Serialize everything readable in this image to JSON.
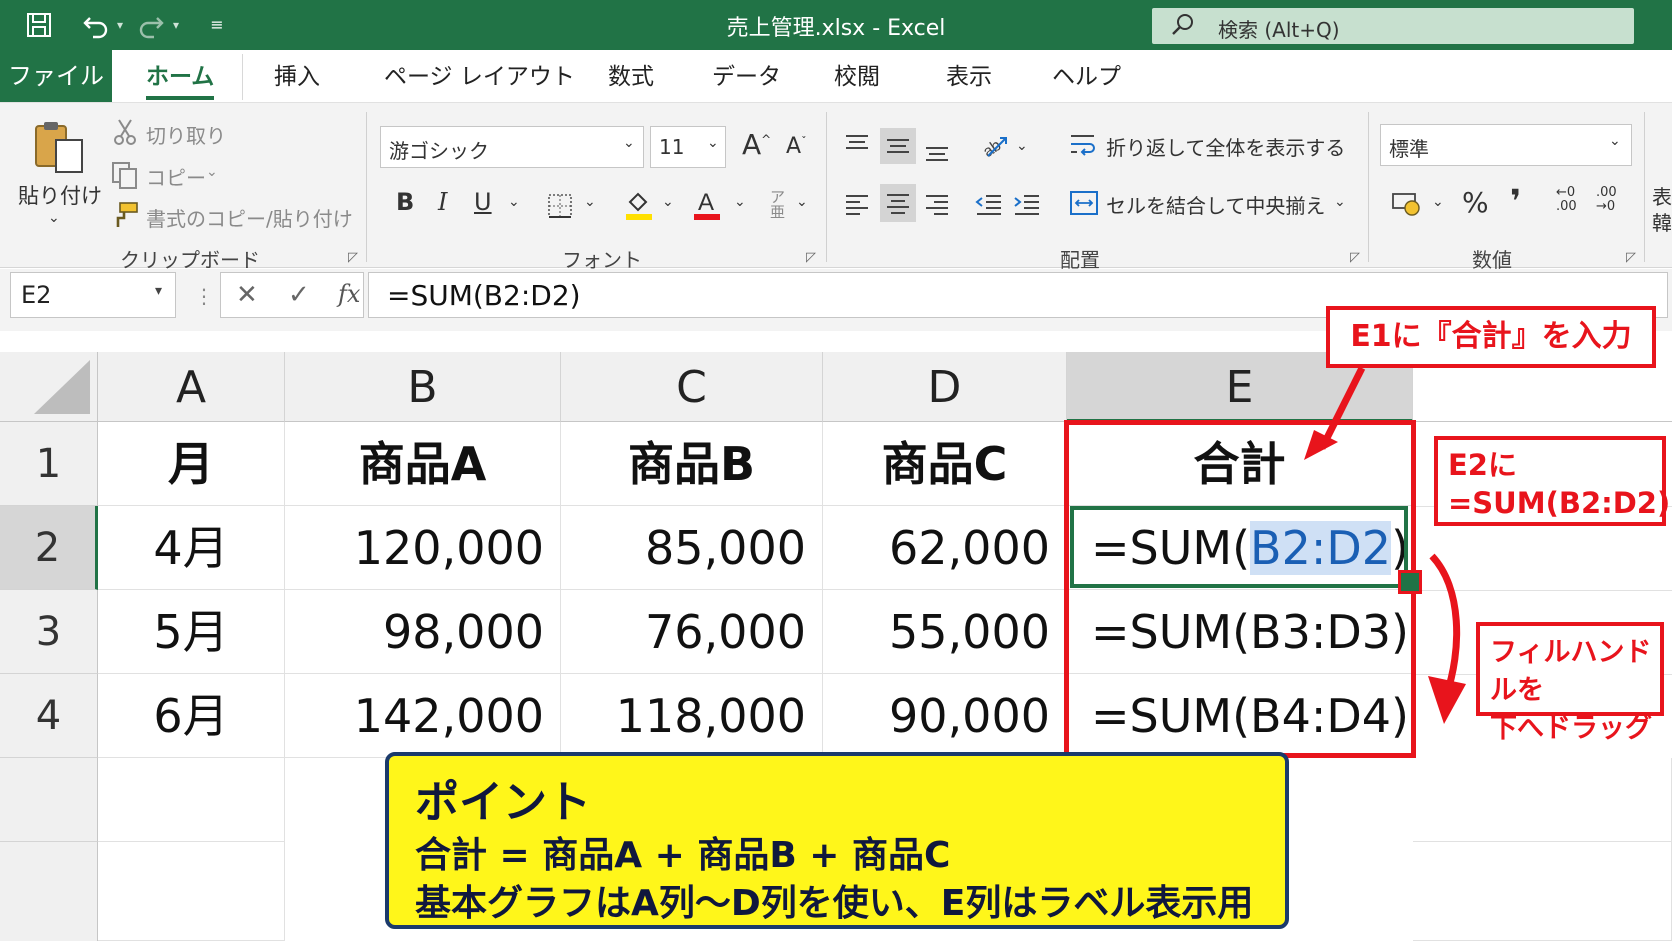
{
  "window": {
    "title": "売上管理.xlsx  -  Excel",
    "search_placeholder": "検索 (Alt+Q)"
  },
  "tabs": [
    "ファイル",
    "ホーム",
    "挿入",
    "ページ レイアウト",
    "数式",
    "データ",
    "校閲",
    "表示",
    "ヘルプ"
  ],
  "ribbon": {
    "clipboard": {
      "paste": "貼り付け",
      "cut": "切り取り",
      "copy": "コピー",
      "format_painter": "書式のコピー/貼り付け",
      "label": "クリップボード"
    },
    "font": {
      "font_name": "游ゴシック",
      "font_size": "11",
      "bold": "B",
      "italic": "I",
      "underline": "U",
      "label": "フォント"
    },
    "alignment": {
      "wrap_text": "折り返して全体を表示する",
      "merge_center": "セルを結合して中央揃え",
      "label": "配置"
    },
    "number": {
      "format": "標準",
      "label": "数値"
    },
    "cutoff_labels": [
      "表",
      "韓"
    ]
  },
  "formula_bar": {
    "name_box": "E2",
    "formula": "=SUM(B2:D2)"
  },
  "sheet": {
    "columns": [
      "A",
      "B",
      "C",
      "D",
      "E"
    ],
    "row_numbers": [
      "1",
      "2",
      "3",
      "4"
    ],
    "rows": [
      [
        "月",
        "商品A",
        "商品B",
        "商品C",
        "合計"
      ],
      [
        "4月",
        "120,000",
        "85,000",
        "62,000",
        "=SUM(B2:D2)"
      ],
      [
        "5月",
        "98,000",
        "76,000",
        "55,000",
        "=SUM(B3:D3)"
      ],
      [
        "6月",
        "142,000",
        "118,000",
        "90,000",
        "=SUM(B4:D4)"
      ]
    ],
    "active_cell": "E2",
    "editing_formula_prefix": "=SUM(",
    "editing_formula_ref": "B2:D2",
    "editing_formula_suffix": ")"
  },
  "annotations": {
    "e1_note": "E1に『合計』を入力",
    "e2_note_line1": "E2に",
    "e2_note_line2": "=SUM(B2:D2)",
    "fill_note_line1": "フィルハンドルを",
    "fill_note_line2": "下へドラッグ",
    "point_title": "ポイント",
    "point_line1": "合計 = 商品A + 商品B + 商品C",
    "point_line2": "基本グラフはA列〜D列を使い、E列はラベル表示用"
  },
  "colors": {
    "excel_green": "#217346",
    "callout_red": "#e8141c",
    "point_yellow": "#fff61a",
    "point_border": "#1b3a6b"
  }
}
